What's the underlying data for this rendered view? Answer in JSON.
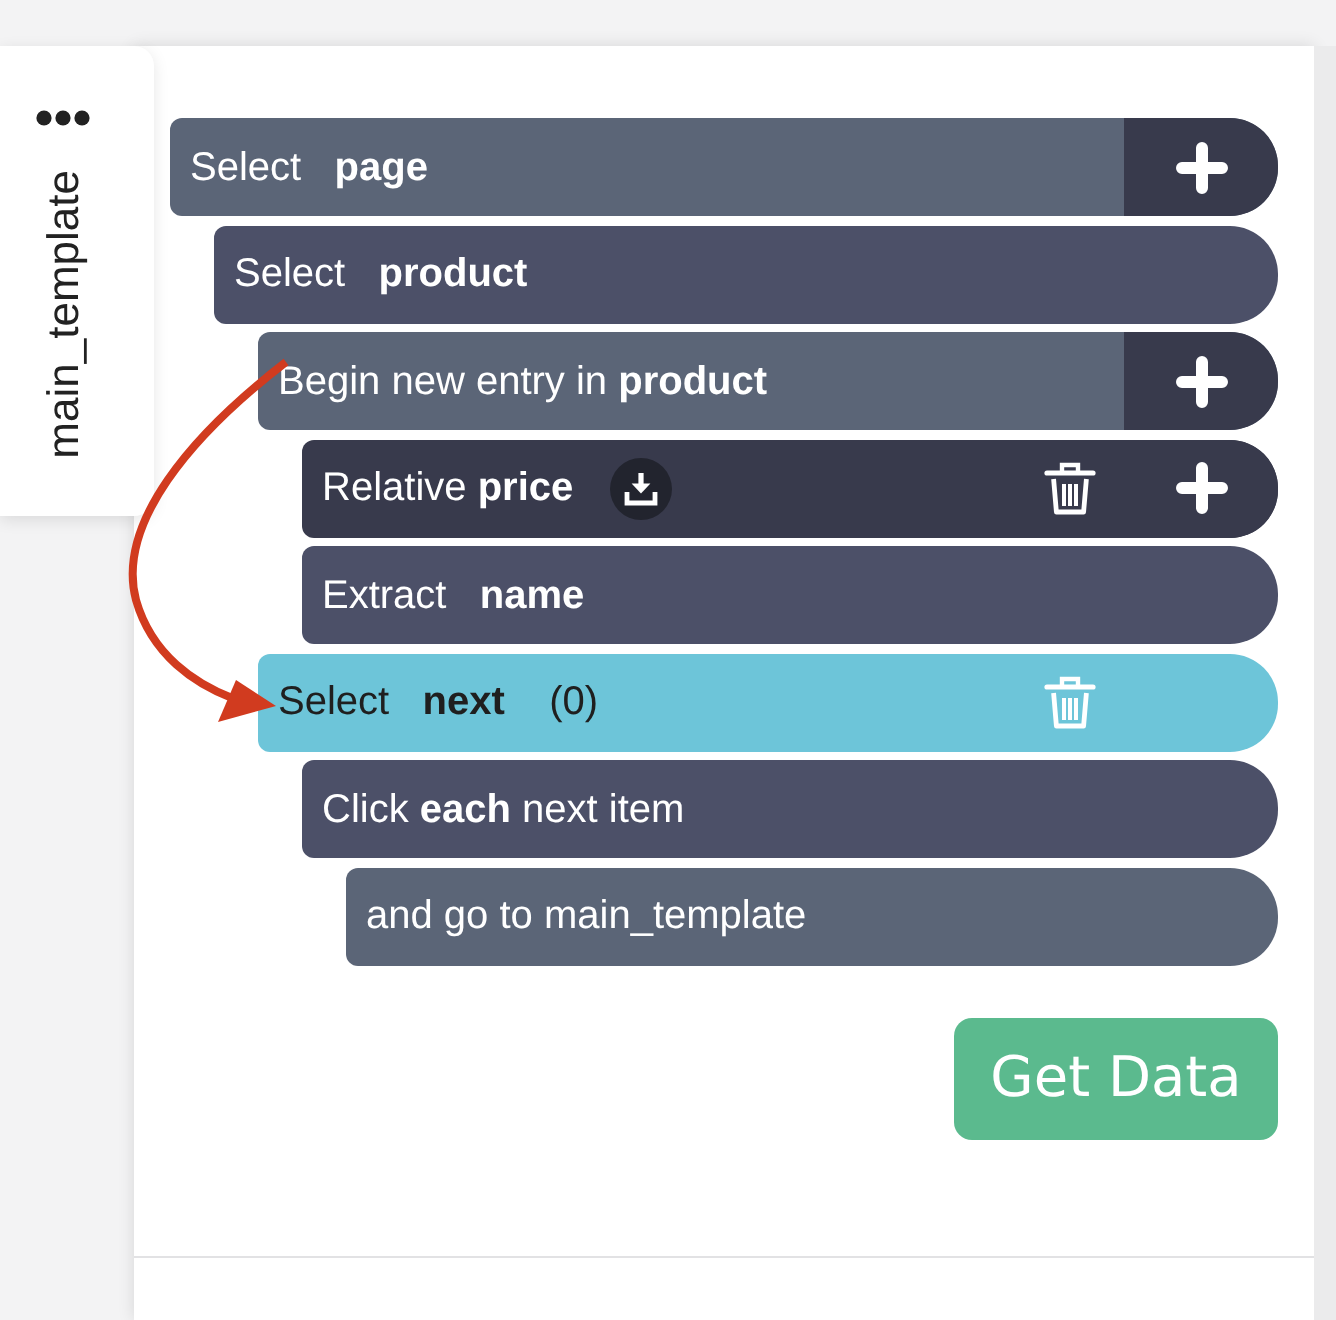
{
  "side_tab": {
    "label": "main_template"
  },
  "steps": [
    {
      "text": "Select   **page**",
      "color": "#5b6577",
      "selected": false,
      "add_button": true,
      "delete_button": false,
      "download_badge": false,
      "children": [
        {
          "text": "Select   **product**",
          "color": "#4c5068",
          "selected": false,
          "add_button": false,
          "delete_button": false,
          "download_badge": false,
          "children": [
            {
              "text": "Begin new entry in **product**",
              "color": "#5b6577",
              "selected": false,
              "add_button": true,
              "delete_button": false,
              "download_badge": false,
              "children": [
                {
                  "text": "Relative **price**",
                  "color": "#383a4c",
                  "selected": false,
                  "add_button": true,
                  "delete_button": true,
                  "download_badge": true
                },
                {
                  "text": "Extract   **name**",
                  "color": "#4c5068",
                  "selected": false,
                  "add_button": false,
                  "delete_button": false,
                  "download_badge": false
                }
              ]
            },
            {
              "text": "Select   **next**    (0)",
              "selected": true,
              "add_button": false,
              "delete_button": true,
              "download_badge": false,
              "children": [
                {
                  "text": "Click **each** next item",
                  "color": "#4c5068",
                  "selected": false,
                  "add_button": false,
                  "delete_button": false,
                  "download_badge": false,
                  "children": [
                    {
                      "text": "and go to main_template",
                      "color": "#5b6577",
                      "selected": false,
                      "add_button": false,
                      "delete_button": false,
                      "download_badge": false
                    }
                  ]
                }
              ]
            }
          ]
        }
      ]
    }
  ],
  "get_data_button": {
    "label": "Get Data"
  }
}
